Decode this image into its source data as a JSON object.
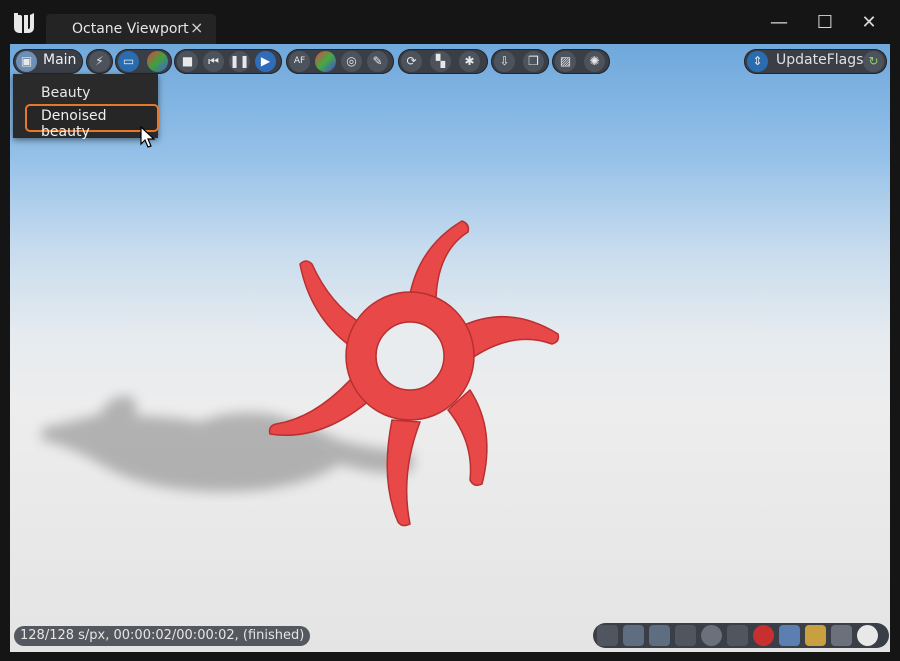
{
  "window": {
    "tab_title": "Octane Viewport",
    "tab_close_glyph": "×",
    "controls": {
      "minimize": "—",
      "maximize": "☐",
      "close": "✕"
    }
  },
  "toolbar": {
    "camera_menu_label": "Main",
    "update_flags_label": "UpdateFlags"
  },
  "menu": {
    "items": [
      {
        "label": "Beauty"
      },
      {
        "label": "Denoised beauty",
        "highlighted": true
      }
    ]
  },
  "status": {
    "text": "128/128 s/px, 00:00:02/00:00:02, (finished)"
  },
  "colors": {
    "accent": "#2b6cb0",
    "highlight_border": "#e8772e",
    "object_color": "#e84848"
  },
  "icons": [
    "unreal-engine-logo",
    "cube-icon",
    "lightning-icon",
    "monitor-icon",
    "color-grid-icon",
    "stop-icon",
    "rewind-icon",
    "pause-icon",
    "play-icon",
    "aov-icon",
    "color-wheel-icon",
    "lens-icon",
    "film-icon",
    "sync-icon",
    "checker-icon",
    "wand-icon",
    "import-icon",
    "cube-stack-icon",
    "image-icon",
    "octane-logo-icon",
    "update-flags-icon",
    "refresh-icon",
    "camera-icon",
    "layers-icon",
    "layers-2-icon",
    "frame-icon",
    "clock-icon",
    "crosshair-icon",
    "red-sphere-icon",
    "blue-cube-icon",
    "gold-cube-icon",
    "picture-icon",
    "star-burst-icon"
  ]
}
